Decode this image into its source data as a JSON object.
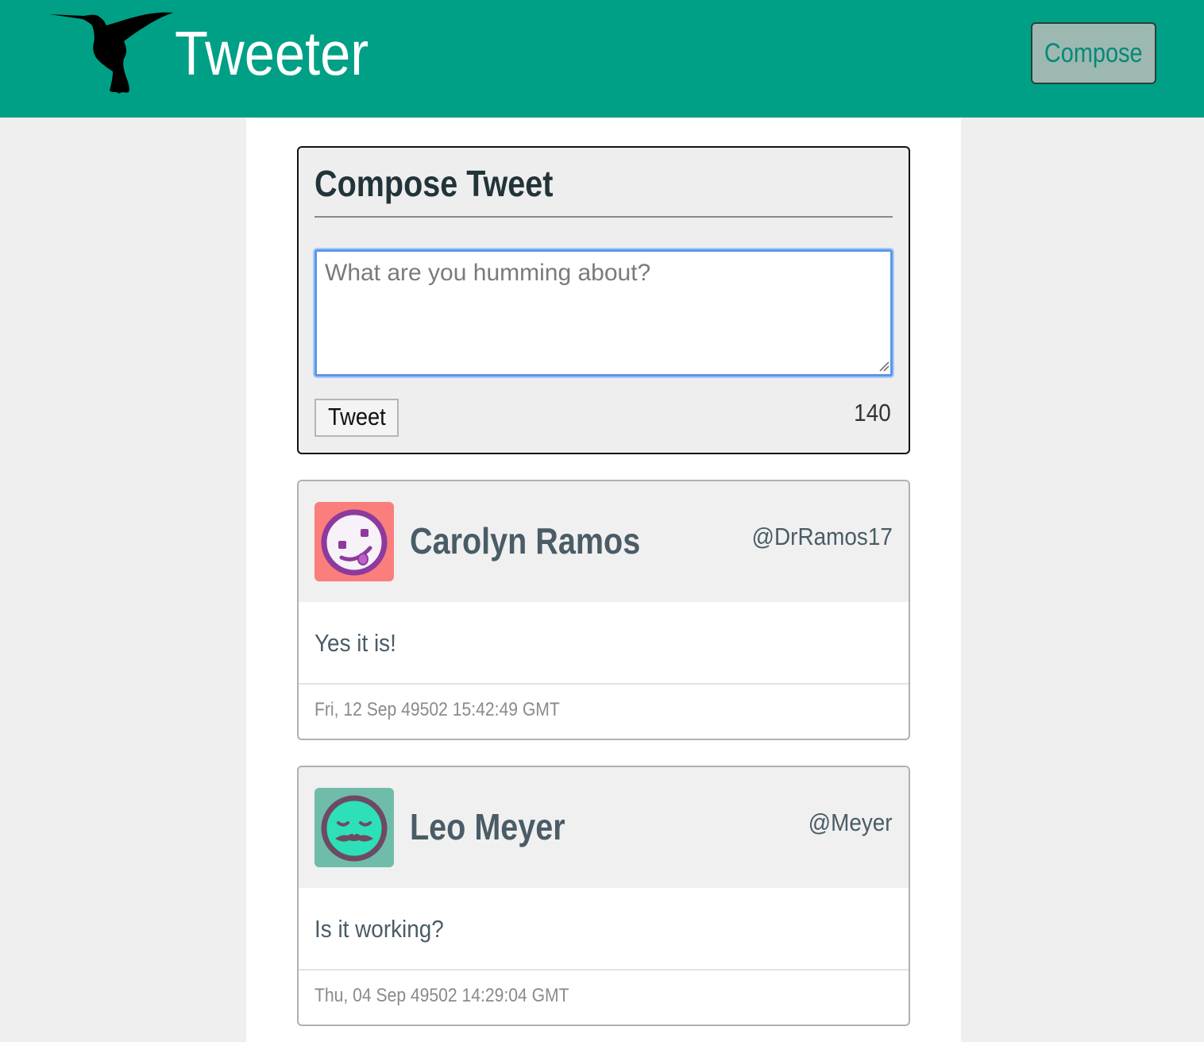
{
  "header": {
    "brand": "Tweeter",
    "compose_button": "Compose",
    "bg_color": "#00a086"
  },
  "compose": {
    "title": "Compose Tweet",
    "placeholder": "What are you humming about?",
    "value": "",
    "submit_label": "Tweet",
    "char_counter": "140"
  },
  "tweets": [
    {
      "name": "Carolyn Ramos",
      "handle": "@DrRamos17",
      "content": "Yes it is!",
      "timestamp": "Fri, 12 Sep 49502 15:42:49 GMT",
      "avatar_icon": "silly-face-avatar-icon",
      "avatar_bg": "#fa7e7c"
    },
    {
      "name": "Leo Meyer",
      "handle": "@Meyer",
      "content": "Is it working?",
      "timestamp": "Thu, 04 Sep 49502 14:29:04 GMT",
      "avatar_icon": "mustache-face-avatar-icon",
      "avatar_bg": "#6fbcab"
    }
  ]
}
